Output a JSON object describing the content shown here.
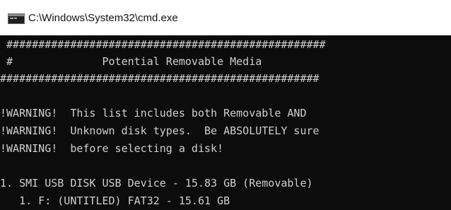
{
  "window": {
    "title": "C:\\Windows\\System32\\cmd.exe",
    "icon": "cmd-console-icon"
  },
  "console": {
    "lines": [
      " ##################################################",
      " #              Potential Removable Media",
      "##################################################",
      "",
      "!WARNING!  This list includes both Removable AND",
      "!WARNING!  Unknown disk types.  Be ABSOLUTELY sure",
      "!WARNING!  before selecting a disk!",
      "",
      "1. SMI USB DISK USB Device - 15.83 GB (Removable)",
      "   1. F: (UNTITLED) FAT32 - 15.61 GB"
    ]
  },
  "colors": {
    "console_background": "#0c0c0c",
    "console_text": "#cfcfcf",
    "titlebar_background": "#ffffff",
    "titlebar_text": "#111111"
  }
}
